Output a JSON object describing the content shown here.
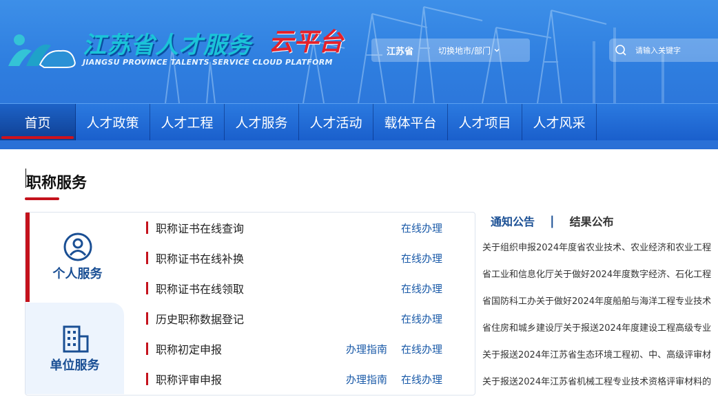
{
  "header": {
    "logo_cn": "江苏省人才服务",
    "logo_cloud": "云平台",
    "logo_en": "JIANGSU PROVINCE TALENTS SERVICE CLOUD PLATFORM",
    "region_label": "江苏省",
    "region_switch_label": "切换地市/部门",
    "search_placeholder": "请输入关键字"
  },
  "nav": {
    "items": [
      {
        "label": "首页",
        "active": true
      },
      {
        "label": "人才政策"
      },
      {
        "label": "人才工程"
      },
      {
        "label": "人才服务"
      },
      {
        "label": "人才活动"
      },
      {
        "label": "载体平台"
      },
      {
        "label": "人才项目"
      },
      {
        "label": "人才风采"
      }
    ]
  },
  "main": {
    "title": "职称服务",
    "tabs": {
      "personal": "个人服务",
      "unit": "单位服务"
    },
    "services": [
      {
        "name": "职称证书在线查询",
        "guide": "",
        "online": "在线办理"
      },
      {
        "name": "职称证书在线补换",
        "guide": "",
        "online": "在线办理"
      },
      {
        "name": "职称证书在线领取",
        "guide": "",
        "online": "在线办理"
      },
      {
        "name": "历史职称数据登记",
        "guide": "",
        "online": "在线办理"
      },
      {
        "name": "职称初定申报",
        "guide": "办理指南",
        "online": "在线办理"
      },
      {
        "name": "职称评审申报",
        "guide": "办理指南",
        "online": "在线办理"
      }
    ],
    "notice": {
      "tab_notice": "通知公告",
      "separator": "|",
      "tab_results": "结果公布",
      "items": [
        "关于组织申报2024年度省农业技术、农业经济和农业工程",
        "省工业和信息化厅关于做好2024年度数字经济、石化工程",
        "省国防科工办关于做好2024年度船舶与海洋工程专业技术",
        "省住房和城乡建设厅关于报送2024年度建设工程高级专业",
        "关于报送2024年江苏省生态环境工程初、中、高级评审材",
        "关于报送2024年江苏省机械工程专业技术资格评审材料的"
      ]
    }
  },
  "colors": {
    "brand_blue": "#2a6fd6",
    "accent_red": "#c4121c",
    "link_blue": "#1a5aa8",
    "tab_title_blue": "#1a4f94"
  }
}
